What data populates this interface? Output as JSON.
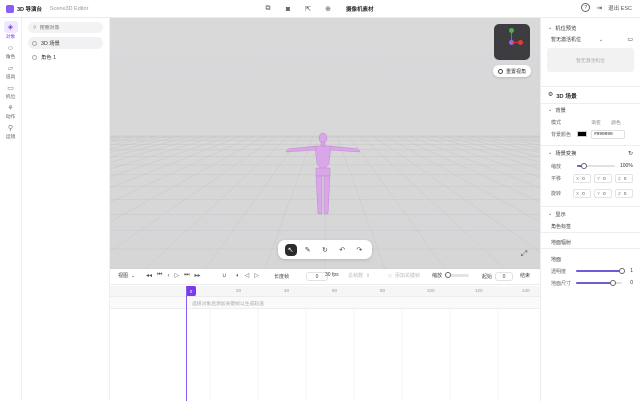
{
  "app": {
    "title": "3D 导演台",
    "separator": "·",
    "subtitle": "Scene3D Editor",
    "camera_save_label": "摄像机素材",
    "help": "?",
    "exit_label": "退出 ESC"
  },
  "rail": {
    "items": [
      {
        "label": "对象",
        "icon": "cube-icon"
      },
      {
        "label": "角色",
        "icon": "person-icon"
      },
      {
        "label": "道具",
        "icon": "prop-icon"
      },
      {
        "label": "机位",
        "icon": "video-camera-icon"
      },
      {
        "label": "动作",
        "icon": "motion-icon"
      },
      {
        "label": "运镜",
        "icon": "camera-move-icon"
      }
    ]
  },
  "tree": {
    "search_placeholder": "搜索对象",
    "items": [
      {
        "label": "3D 场景",
        "selected": true
      },
      {
        "label": "角色 1",
        "selected": false
      }
    ]
  },
  "viewport": {
    "reset_view_label": "重置视角",
    "gizmo_axes": [
      "Y",
      "X",
      "Z"
    ],
    "tools": [
      "select-tool-icon",
      "edit-tool-icon",
      "rotate-tool-icon",
      "undo-icon",
      "redo-icon"
    ]
  },
  "timeline": {
    "view_label": "视图",
    "duration_label": "长度帧",
    "duration_value": "0",
    "fps_label": "30 fps",
    "loop_label": "总帧数",
    "track_hint_label": "添加关键帧",
    "zoom_label": "缩放",
    "start_label": "起始",
    "start_value": "0",
    "end_label": "结束",
    "ruler_ticks": [
      "0",
      "20",
      "40",
      "60",
      "80",
      "100",
      "120",
      "140"
    ],
    "playhead_frame": "0",
    "empty_hint": "选择对象后添加关键帧以生成轨道"
  },
  "right": {
    "camera_section": "机位预览",
    "camera_select": "暂无激活机位",
    "camera_placeholder": "暂无激活机位",
    "scene_title": "3D 场景",
    "background_section": "背景",
    "mode_label": "模式",
    "mode_options": [
      "渐变",
      "颜色"
    ],
    "bg_color_label": "背景颜色",
    "bg_color_value": "#999999",
    "bg_color": "#000000",
    "transform_section": "场景变换",
    "scale_label": "缩放",
    "scale_value": "100%",
    "scale_level": 0.18,
    "position_label": "平移",
    "rotation_label": "旋转",
    "xyz_axes": [
      "X",
      "Y",
      "Z"
    ],
    "xyz_values": [
      "0",
      "0",
      "0"
    ],
    "display_section": "显示",
    "display_rows": [
      "角色标签",
      "地面辐射"
    ],
    "ground_label": "地面",
    "opacity_label": "透明度",
    "opacity_value": "1",
    "opacity_level": 1.0,
    "ground_size_label": "地面尺寸",
    "ground_size_value": "0",
    "ground_size_level": 0.8
  },
  "colors": {
    "accent": "#7c3aed",
    "viewport_bg": "#d8d8d9",
    "figure": "#d9a6e8"
  }
}
